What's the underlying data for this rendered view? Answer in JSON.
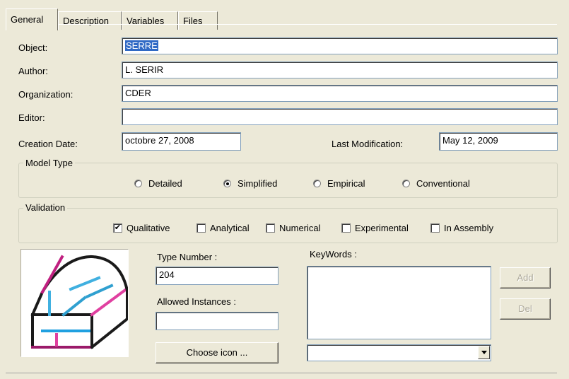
{
  "tabs": [
    {
      "label": "General"
    },
    {
      "label": "Description"
    },
    {
      "label": "Variables"
    },
    {
      "label": "Files"
    }
  ],
  "fields": {
    "object": {
      "label": "Object:",
      "value": "SERRE"
    },
    "author": {
      "label": "Author:",
      "value": "L. SERIR"
    },
    "organization": {
      "label": "Organization:",
      "value": "CDER"
    },
    "editor": {
      "label": "Editor:",
      "value": ""
    },
    "creation_date": {
      "label": "Creation Date:",
      "value": "octobre 27, 2008"
    },
    "last_modification": {
      "label": "Last Modification:",
      "value": "May 12, 2009"
    }
  },
  "model_type": {
    "title": "Model Type",
    "options": [
      {
        "label": "Detailed",
        "selected": false
      },
      {
        "label": "Simplified",
        "selected": true
      },
      {
        "label": "Empirical",
        "selected": false
      },
      {
        "label": "Conventional",
        "selected": false
      }
    ]
  },
  "validation": {
    "title": "Validation",
    "options": [
      {
        "label": "Qualitative",
        "checked": true
      },
      {
        "label": "Analytical",
        "checked": false
      },
      {
        "label": "Numerical",
        "checked": false
      },
      {
        "label": "Experimental",
        "checked": false
      },
      {
        "label": "In Assembly",
        "checked": false
      }
    ]
  },
  "type_number": {
    "label": "Type Number :",
    "value": "204"
  },
  "allowed_instances": {
    "label": "Allowed Instances :",
    "value": ""
  },
  "choose_icon_label": "Choose icon ...",
  "keywords": {
    "label": "KeyWords :",
    "combo_value": ""
  },
  "buttons": {
    "add": "Add",
    "del": "Del"
  },
  "icon": "greenhouse-model-icon",
  "colors": {
    "selection": "#316AC5",
    "background": "#ECE9D8"
  }
}
